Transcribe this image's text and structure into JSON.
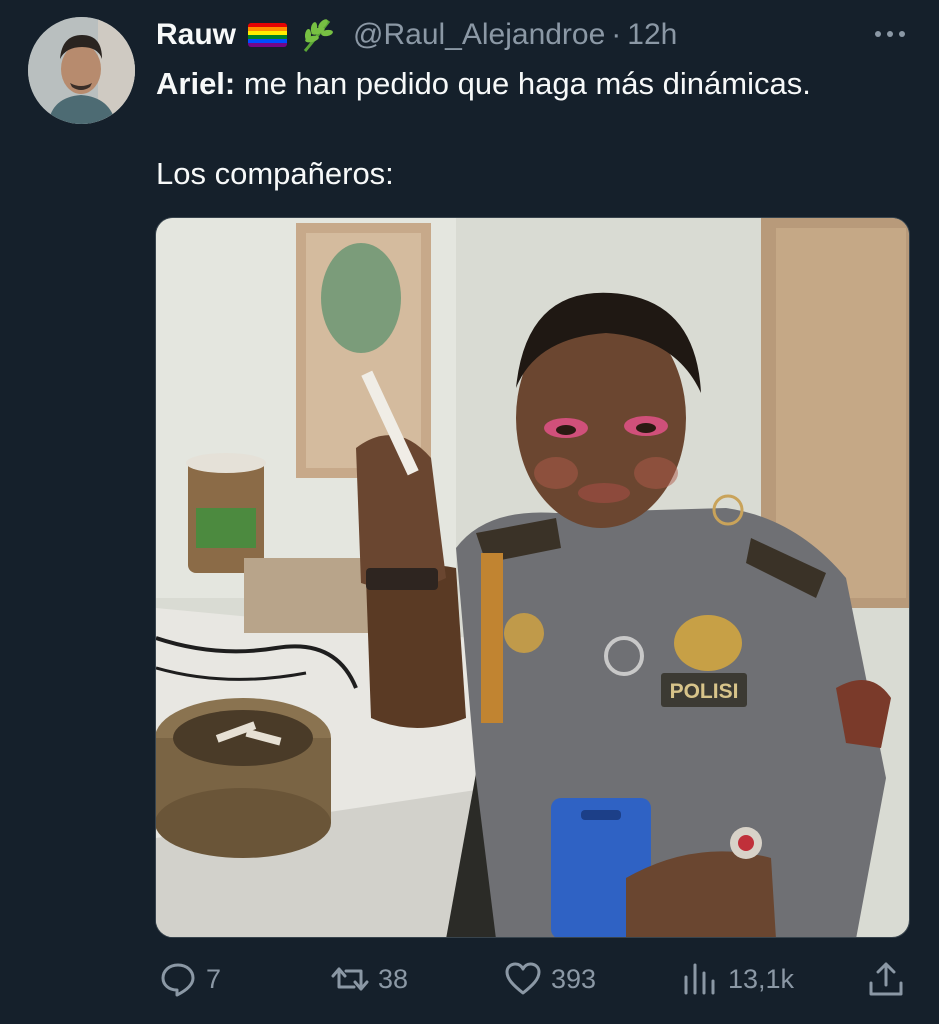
{
  "tweet": {
    "display_name": "Rauw",
    "badges": [
      "rainbow-flag-emoji",
      "herb-emoji"
    ],
    "handle": "@Raul_Alejandroe",
    "separator": "·",
    "time": "12h",
    "more_icon": "more-horizontal-icon",
    "text_bold": "Ariel:",
    "text_line1_rest": " me han pedido que haga más dinámicas.",
    "text_line3": "Los compañeros:",
    "media": {
      "description_visible_text": "POLISI"
    }
  },
  "actions": {
    "reply_count": "7",
    "retweet_count": "38",
    "like_count": "393",
    "views_count": "13,1k",
    "icons": [
      "reply-icon",
      "retweet-icon",
      "like-icon",
      "views-icon",
      "share-icon"
    ]
  },
  "colors": {
    "background": "#15202b",
    "text": "#f7f9f9",
    "secondary_text": "#8b98a5",
    "border": "#38444d"
  }
}
